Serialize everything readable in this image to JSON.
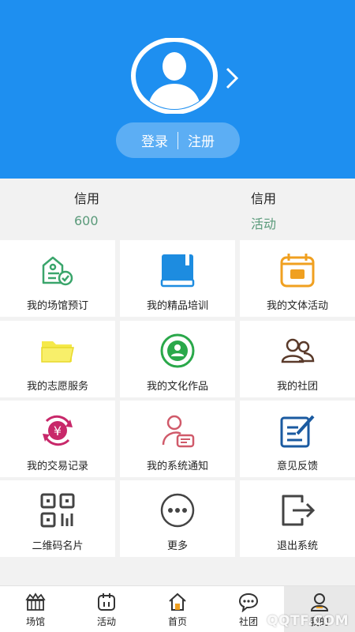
{
  "header": {
    "login_label": "登录",
    "register_label": "注册",
    "bg_color": "#1e8ff0"
  },
  "credits": [
    {
      "title": "信用",
      "value": "600"
    },
    {
      "title": "信用",
      "value": "活动"
    }
  ],
  "grid": {
    "items": [
      {
        "label": "我的场馆预订",
        "icon": "venue-booking-icon"
      },
      {
        "label": "我的精品培训",
        "icon": "book-icon"
      },
      {
        "label": "我的文体活动",
        "icon": "calendar-icon"
      },
      {
        "label": "我的志愿服务",
        "icon": "folder-icon"
      },
      {
        "label": "我的文化作品",
        "icon": "user-circle-icon"
      },
      {
        "label": "我的社团",
        "icon": "group-icon"
      },
      {
        "label": "我的交易记录",
        "icon": "yuan-exchange-icon"
      },
      {
        "label": "我的系统通知",
        "icon": "notification-user-icon"
      },
      {
        "label": "意见反馈",
        "icon": "feedback-edit-icon"
      },
      {
        "label": "二维码名片",
        "icon": "qrcode-icon"
      },
      {
        "label": "更多",
        "icon": "more-icon"
      },
      {
        "label": "退出系统",
        "icon": "logout-icon"
      }
    ]
  },
  "bottom_nav": {
    "items": [
      {
        "label": "场馆",
        "icon": "stadium-icon"
      },
      {
        "label": "活动",
        "icon": "activity-icon"
      },
      {
        "label": "首页",
        "icon": "home-icon"
      },
      {
        "label": "社团",
        "icon": "chat-icon"
      },
      {
        "label": "我的",
        "icon": "profile-icon"
      }
    ],
    "active_index": 4
  },
  "watermark": "QQTF.COM"
}
